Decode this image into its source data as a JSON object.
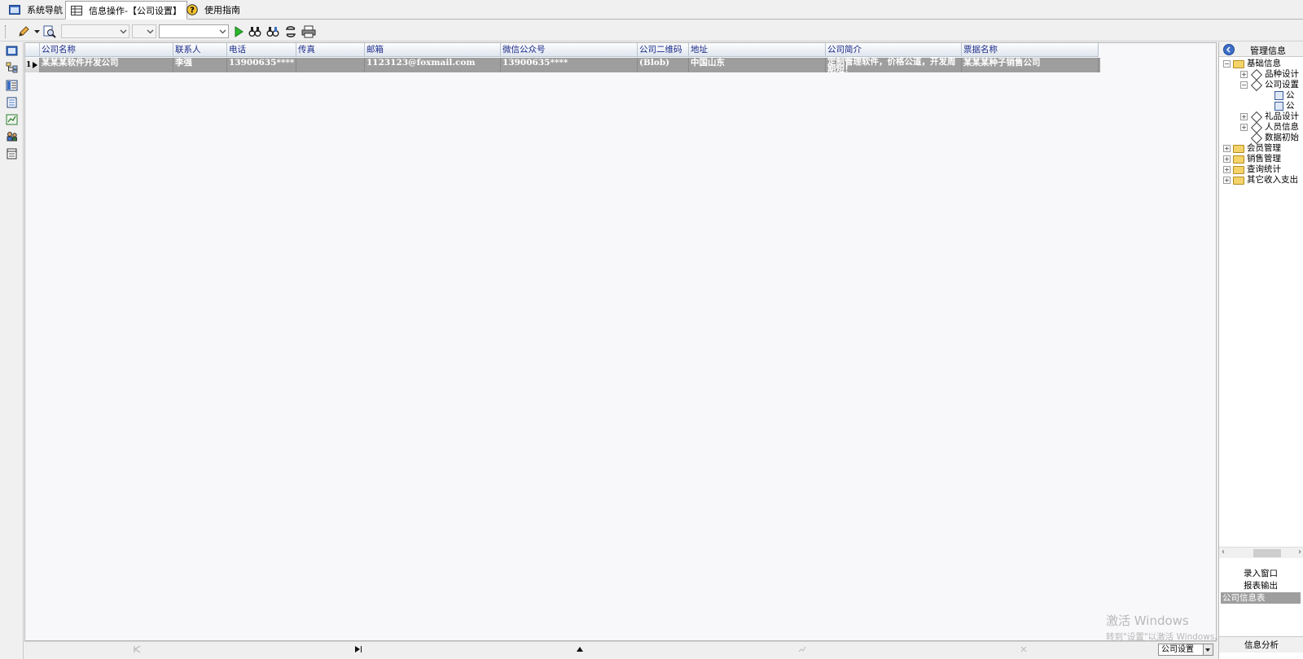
{
  "tabs": [
    {
      "label": "系统导航",
      "icon": "app-window-icon"
    },
    {
      "label": "信息操作-【公司设置】",
      "icon": "grid-table-icon",
      "active": true
    },
    {
      "label": "使用指南",
      "icon": "help-icon"
    }
  ],
  "toolbar": {
    "edit_icon": "pencil-icon",
    "preview_icon": "magnifier-icon",
    "combo1_value": "",
    "combo2_value": "",
    "combo3_value": "",
    "run_icon": "play-icon",
    "find_icon": "binoculars-icon",
    "find_next_icon": "binoculars-next-icon",
    "refresh_icon": "refresh-icon",
    "print_icon": "printer-icon"
  },
  "leftbar": {
    "icons": [
      "window-icon",
      "tree-structure-icon",
      "form-icon",
      "document-icon",
      "chart-icon",
      "users-icon",
      "list-icon"
    ]
  },
  "grid": {
    "columns": [
      "公司名称",
      "联系人",
      "电话",
      "传真",
      "邮箱",
      "微信公众号",
      "公司二维码",
      "地址",
      "公司简介",
      "票据名称"
    ],
    "rows": [
      {
        "indicator": "1",
        "cells": [
          "某某某软件开发公司",
          "李强",
          "13900635****",
          "",
          "1123123@foxmail.com",
          "13900635****",
          "(Blob)",
          "中国山东",
          "定制管理软件，价格公道，开发周期短！",
          "某某某种子销售公司"
        ]
      }
    ]
  },
  "statusbar": {
    "select_value": "公司设置"
  },
  "rightpanel": {
    "title": "管理信息",
    "tree": {
      "root": "基础信息",
      "children": [
        "品种设计",
        "公司设置",
        "公",
        "公",
        "礼品设计",
        "人员信息",
        "数据初始"
      ],
      "others": [
        "会员管理",
        "销售管理",
        "查询统计",
        "其它收入支出"
      ]
    },
    "buttons": [
      "录入窗口",
      "报表输出",
      "公司信息表"
    ],
    "bottom": "信息分析"
  },
  "watermark": {
    "line1": "激活 Windows",
    "line2": "转到\"设置\"以激活 Windows。"
  }
}
